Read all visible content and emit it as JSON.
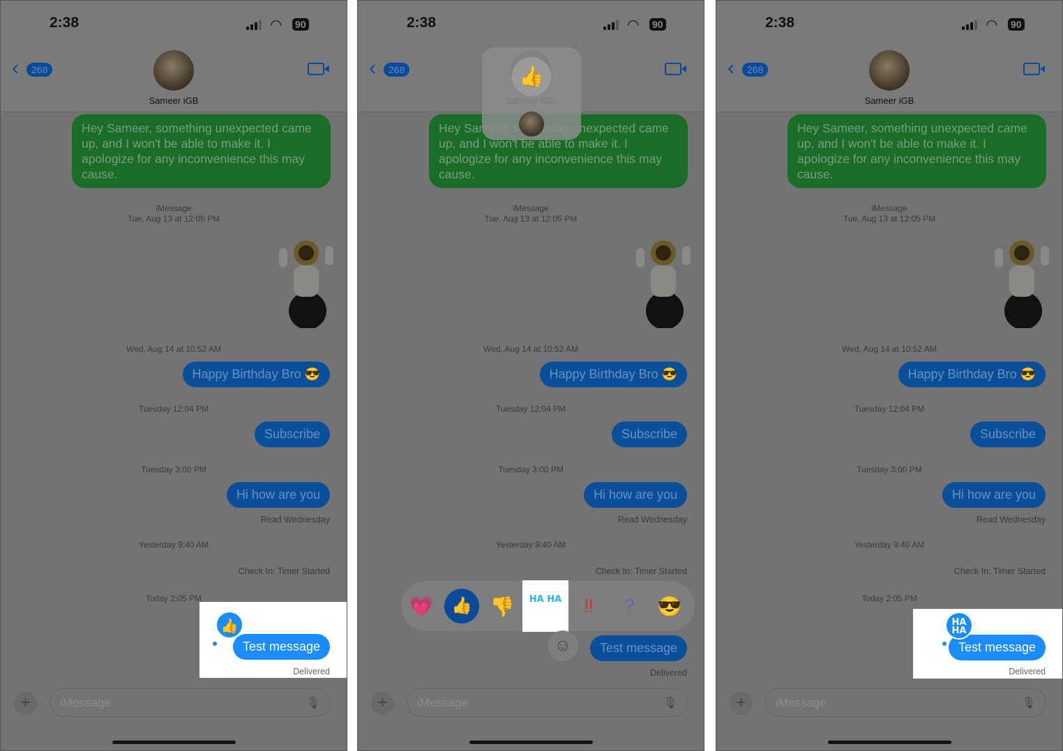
{
  "status": {
    "time": "2:38",
    "battery": "90"
  },
  "header": {
    "back_count": "268",
    "contact_name": "Sameer iGB"
  },
  "messages": {
    "green_text": "Hey Sameer, something unexpected came up, and I won't be able to make it. I apologize for any inconvenience this may cause.",
    "service": "iMessage",
    "ts1": "Tue, Aug 13 at 12:05 PM",
    "ts2": "Wed, Aug 14 at 10:52 AM",
    "m_birthday": "Happy Birthday Bro 😎",
    "ts3": "Tuesday 12:04 PM",
    "m_subscribe": "Subscribe",
    "ts4": "Tuesday 3:00 PM",
    "m_hi": "Hi how are you",
    "read": "Read Wednesday",
    "ts5": "Yesterday 9:40 AM",
    "checkin": "Check In: Timer Started",
    "ts6": "Today 2:05 PM",
    "m_test": "Test message",
    "delivered": "Delivered"
  },
  "composer": {
    "placeholder": "iMessage"
  },
  "reactions": {
    "options": [
      "heart",
      "thumbs-up",
      "thumbs-down",
      "haha",
      "exclamation",
      "question",
      "sunglasses-emoji"
    ],
    "haha_text": "HA HA",
    "selected_panel1": "thumbs-up",
    "selected_panel3": "haha"
  },
  "colors": {
    "imessage_blue": "#1a8cff",
    "sms_green": "#34c759",
    "dim_overlay": "#737373"
  }
}
